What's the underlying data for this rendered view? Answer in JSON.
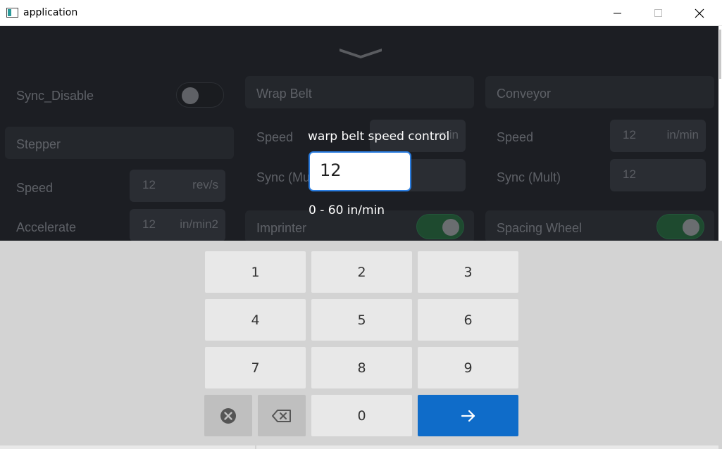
{
  "window": {
    "title": "application",
    "icon": "app-window-icon",
    "controls": [
      "minimize-icon",
      "maximize-icon",
      "close-icon"
    ]
  },
  "background": {
    "sync_disable": {
      "label": "Sync_Disable",
      "toggle_on": false
    },
    "stepper": {
      "title": "Stepper",
      "speed": {
        "label": "Speed",
        "value": "12",
        "unit": "rev/s"
      },
      "accelerate": {
        "label": "Accelerate",
        "value": "12",
        "unit": "in/min2"
      }
    },
    "wrap_belt": {
      "title": "Wrap Belt",
      "speed": {
        "label": "Speed",
        "unit_partial": "min"
      },
      "sync": {
        "label": "Sync (Mu"
      }
    },
    "conveyor": {
      "title": "Conveyor",
      "speed": {
        "label": "Speed",
        "value": "12",
        "unit": "in/min"
      },
      "sync": {
        "label": "Sync (Mult)",
        "value": "12"
      }
    },
    "imprinter": {
      "label": "Imprinter",
      "toggle_on": true
    },
    "spacing_wheel": {
      "label": "Spacing Wheel",
      "toggle_on": true
    }
  },
  "dialog": {
    "title": "warp belt speed control",
    "value": "12",
    "range": "0 - 60 in/min"
  },
  "keypad": {
    "keys": [
      "1",
      "2",
      "3",
      "4",
      "5",
      "6",
      "7",
      "8",
      "9",
      "0"
    ],
    "clear_icon": "clear-circle-x-icon",
    "backspace_icon": "backspace-icon",
    "enter_icon": "arrow-right-icon"
  },
  "colors": {
    "accent": "#0f6cc9",
    "input_border": "#2a7de1",
    "toggle_on": "#1e4a2f",
    "app_bg": "#1c1e23",
    "keypad_bg": "#d3d3d3"
  }
}
